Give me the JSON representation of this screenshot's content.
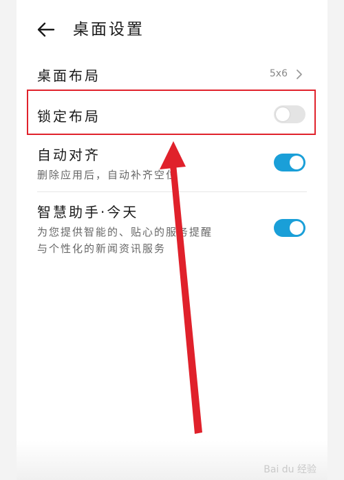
{
  "header": {
    "title": "桌面设置",
    "back_icon": "arrow-left-icon"
  },
  "settings": {
    "layout": {
      "label": "桌面布局",
      "value": "5x6"
    },
    "lock_layout": {
      "label": "锁定布局",
      "enabled": false
    },
    "auto_align": {
      "label": "自动对齐",
      "description": "删除应用后，自动补齐空位",
      "enabled": true
    },
    "smart_assistant": {
      "label": "智慧助手·今天",
      "description_line1": "为您提供智能的、贴心的服务提醒",
      "description_line2": "与个性化的新闻资讯服务",
      "enabled": true
    }
  },
  "annotation": {
    "highlight_color": "#e0212b"
  },
  "watermark": "Bai du 经验",
  "colors": {
    "toggle_on": "#1a9fd8",
    "toggle_off": "#e4e4e4"
  }
}
